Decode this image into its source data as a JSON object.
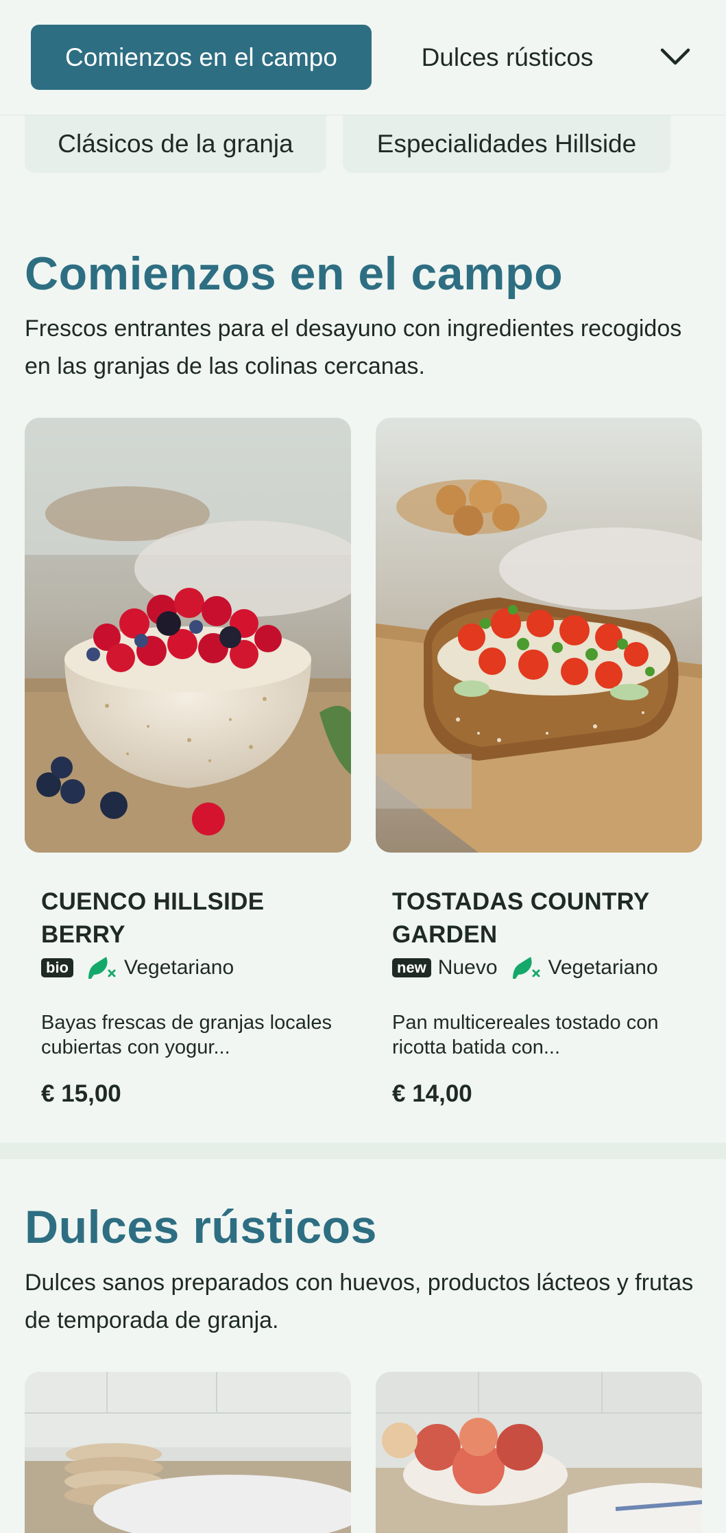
{
  "nav": {
    "active_tab": "Comienzos en el campo",
    "tab_2": "Dulces rústicos",
    "row2": [
      "Clásicos de la granja",
      "Especialidades Hillside"
    ],
    "chevron_icon": "chevron-down-icon"
  },
  "sections": [
    {
      "title": "Comienzos en el campo",
      "description": "Frescos entrantes para el desayuno con ingredientes recogidos en las granjas de las colinas cercanas.",
      "items": [
        {
          "name": "CUENCO HILLSIDE BERRY",
          "badges": [
            "bio"
          ],
          "tags": [
            "Vegetariano"
          ],
          "description": "Bayas frescas de granjas locales cubiertas con yogur...",
          "price": "€ 15,00"
        },
        {
          "name": "TOSTADAS COUNTRY GARDEN",
          "badges": [
            "new"
          ],
          "badge_label": "Nuevo",
          "tags": [
            "Vegetariano"
          ],
          "description": "Pan multicereales tostado con ricotta batida con...",
          "price": "€ 14,00"
        }
      ]
    },
    {
      "title": "Dulces rústicos",
      "description": "Dulces sanos preparados con huevos, productos lácteos y frutas de temporada de granja."
    }
  ],
  "colors": {
    "accent": "#2e6e82",
    "background": "#f1f6f2",
    "veg_icon": "#14a86a",
    "text": "#1f2a24"
  }
}
